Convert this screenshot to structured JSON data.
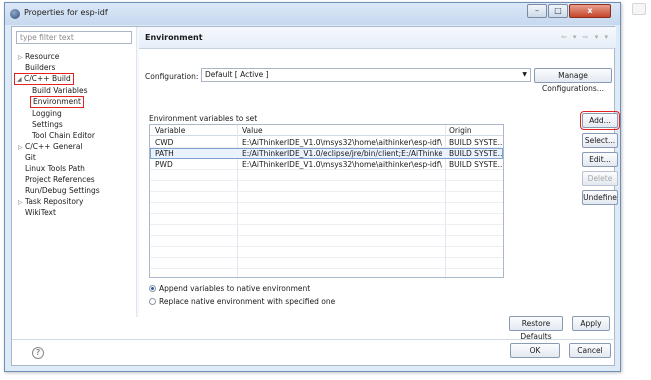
{
  "window": {
    "title": "Properties for esp-idf",
    "min_glyph": "–",
    "max_glyph": "□",
    "close_glyph": "x"
  },
  "sidebar": {
    "filter_placeholder": "type filter text",
    "items": [
      {
        "label": "Resource",
        "arrow": "▷"
      },
      {
        "label": "Builders",
        "arrow": ""
      },
      {
        "label": "C/C++ Build",
        "arrow": "◢"
      },
      {
        "label": "Build Variables",
        "arrow": ""
      },
      {
        "label": "Environment",
        "arrow": ""
      },
      {
        "label": "Logging",
        "arrow": ""
      },
      {
        "label": "Settings",
        "arrow": ""
      },
      {
        "label": "Tool Chain Editor",
        "arrow": ""
      },
      {
        "label": "C/C++ General",
        "arrow": "▷"
      },
      {
        "label": "Git",
        "arrow": ""
      },
      {
        "label": "Linux Tools Path",
        "arrow": ""
      },
      {
        "label": "Project References",
        "arrow": ""
      },
      {
        "label": "Run/Debug Settings",
        "arrow": ""
      },
      {
        "label": "Task Repository",
        "arrow": "▷"
      },
      {
        "label": "WikiText",
        "arrow": ""
      }
    ]
  },
  "page": {
    "title": "Environment",
    "nav_glyphs": "⇦ ▾ ⇨ ▾ ▾"
  },
  "configuration": {
    "label": "Configuration:",
    "value": "Default  [ Active ]",
    "manage_button": "Manage Configurations..."
  },
  "env": {
    "section_label": "Environment variables to set",
    "columns": [
      "Variable",
      "Value",
      "Origin"
    ],
    "rows": [
      {
        "variable": "CWD",
        "value": "E:\\AiThinkerIDE_V1.0\\msys32\\home\\aithinker\\esp-idf\\exa...",
        "origin": "BUILD SYSTE..."
      },
      {
        "variable": "PATH",
        "value": "E:/AiThinkerIDE_V1.0/eclipse/jre/bin/client;E:/AiThinkerIDE...",
        "origin": "BUILD SYSTE..."
      },
      {
        "variable": "PWD",
        "value": "E:\\AiThinkerIDE_V1.0\\msys32\\home\\aithinker\\esp-idf\\exa...",
        "origin": "BUILD SYSTE..."
      }
    ],
    "buttons": {
      "add": "Add...",
      "select": "Select...",
      "edit": "Edit...",
      "delete": "Delete",
      "undefine": "Undefine"
    }
  },
  "mode": {
    "append": "Append variables to native environment",
    "replace": "Replace native environment with specified one"
  },
  "actions": {
    "restore_defaults": "Restore Defaults",
    "apply": "Apply",
    "ok": "OK",
    "cancel": "Cancel"
  },
  "help": {
    "glyph": "?"
  },
  "colors": {
    "highlight_box": "#e32222",
    "selection": "#eaf2fd",
    "titlebar": "#c7d9ef"
  }
}
